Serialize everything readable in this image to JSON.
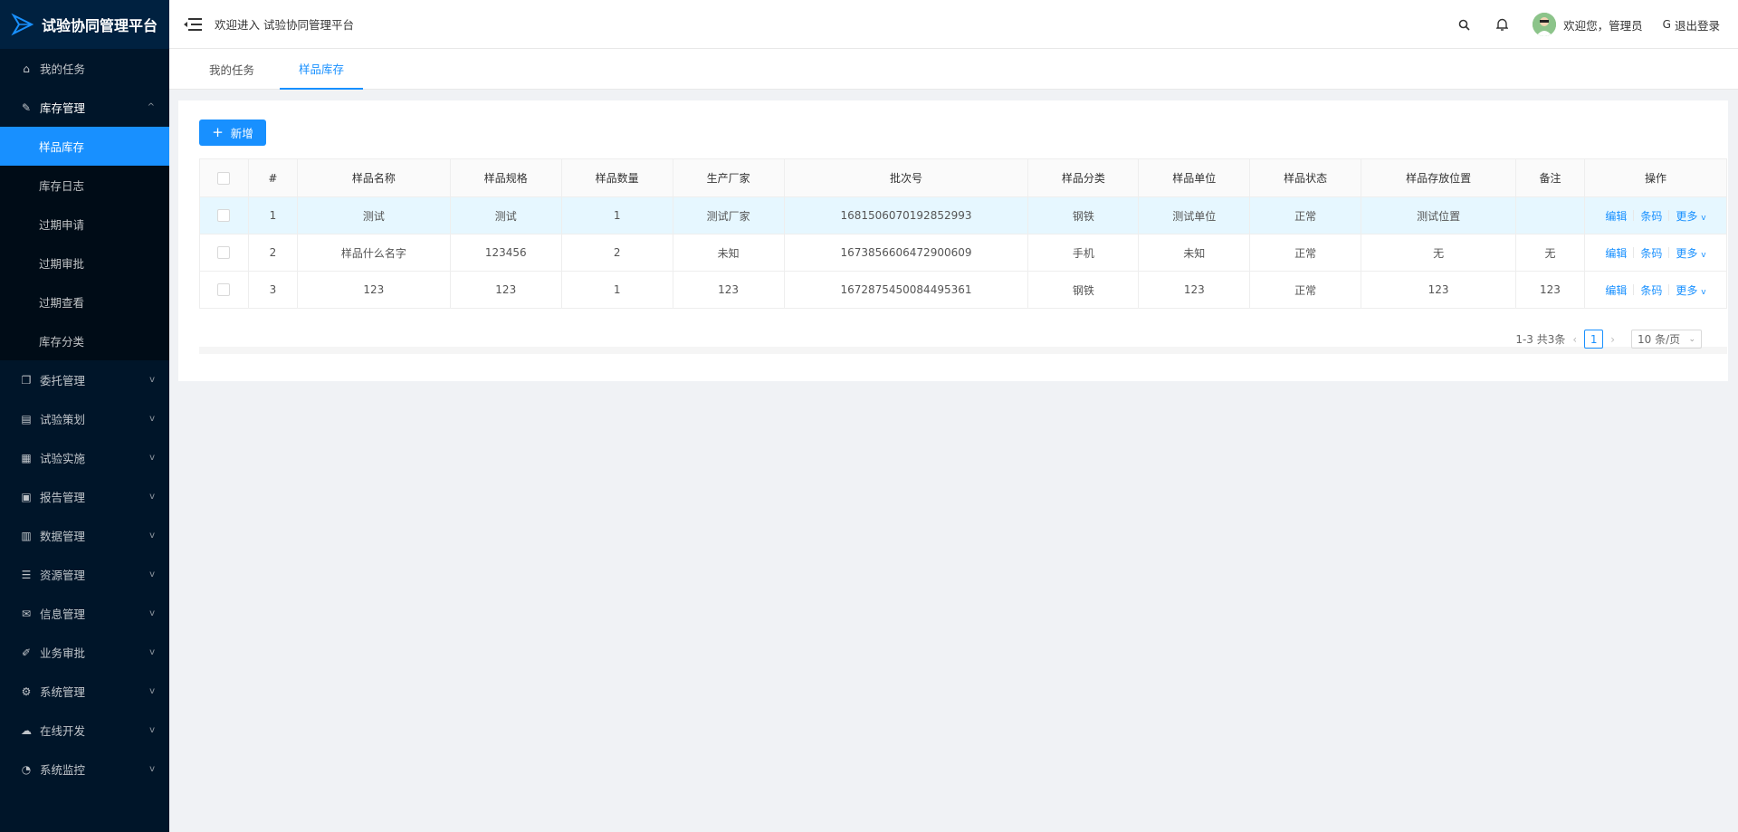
{
  "app": {
    "title": "试验协同管理平台"
  },
  "header": {
    "welcome": "欢迎进入 试验协同管理平台",
    "greeting": "欢迎您，管理员",
    "logout": "退出登录"
  },
  "sidebar": {
    "items": [
      {
        "label": "我的任务",
        "icon": "home-icon"
      },
      {
        "label": "库存管理",
        "icon": "wrench-icon",
        "open": true,
        "children": [
          "样品库存",
          "库存日志",
          "过期申请",
          "过期审批",
          "过期查看",
          "库存分类"
        ]
      },
      {
        "label": "委托管理",
        "icon": "copy-icon"
      },
      {
        "label": "试验策划",
        "icon": "calendar-icon"
      },
      {
        "label": "试验实施",
        "icon": "grid-icon"
      },
      {
        "label": "报告管理",
        "icon": "report-icon"
      },
      {
        "label": "数据管理",
        "icon": "chart-icon"
      },
      {
        "label": "资源管理",
        "icon": "list-icon"
      },
      {
        "label": "信息管理",
        "icon": "mail-icon"
      },
      {
        "label": "业务审批",
        "icon": "pen-icon"
      },
      {
        "label": "系统管理",
        "icon": "gear-icon"
      },
      {
        "label": "在线开发",
        "icon": "cloud-icon"
      },
      {
        "label": "系统监控",
        "icon": "dashboard-icon"
      }
    ]
  },
  "tabs": [
    "我的任务",
    "样品库存"
  ],
  "toolbar": {
    "add_label": "新增"
  },
  "table": {
    "headers": [
      "#",
      "样品名称",
      "样品规格",
      "样品数量",
      "生产厂家",
      "批次号",
      "样品分类",
      "样品单位",
      "样品状态",
      "样品存放位置",
      "备注",
      "操作"
    ],
    "rows": [
      [
        "1",
        "测试",
        "测试",
        "1",
        "测试厂家",
        "1681506070192852993",
        "钢铁",
        "测试单位",
        "正常",
        "测试位置",
        ""
      ],
      [
        "2",
        "样品什么名字",
        "123456",
        "2",
        "未知",
        "1673856606472900609",
        "手机",
        "未知",
        "正常",
        "无",
        "无"
      ],
      [
        "3",
        "123",
        "123",
        "1",
        "123",
        "1672875450084495361",
        "钢铁",
        "123",
        "正常",
        "123",
        "123"
      ]
    ],
    "ops": [
      "编辑",
      "条码",
      "更多"
    ]
  },
  "pager": {
    "summary": "1-3 共3条",
    "page": "1",
    "size": "10 条/页"
  }
}
